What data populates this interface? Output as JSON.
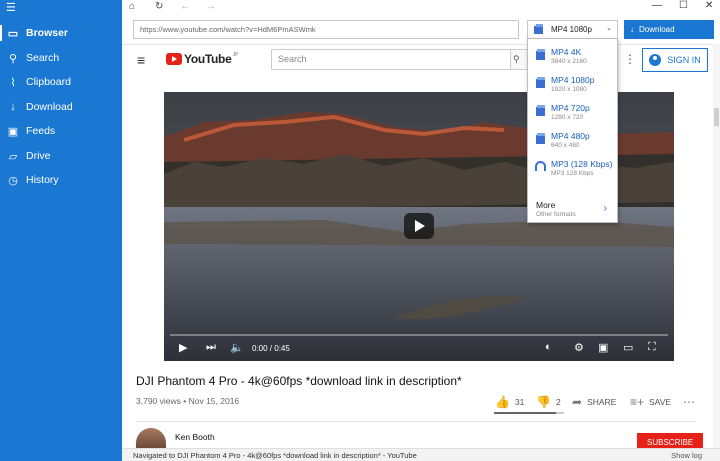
{
  "sidebar": {
    "menu_icon": "hamburger-icon",
    "items": [
      {
        "label": "Browser",
        "icon": "browser-icon",
        "active": true
      },
      {
        "label": "Search",
        "icon": "search-icon"
      },
      {
        "label": "Clipboard",
        "icon": "paperclip-icon"
      },
      {
        "label": "Download",
        "icon": "download-arrow-icon"
      },
      {
        "label": "Feeds",
        "icon": "rss-icon"
      },
      {
        "label": "Drive",
        "icon": "folder-icon"
      },
      {
        "label": "History",
        "icon": "history-icon"
      }
    ]
  },
  "toolbar": {
    "url": "https://www.youtube.com/watch?v=HdM6PmASWmk",
    "format_selected": "MP4 1080p",
    "download_label": "Download"
  },
  "format_dropdown": {
    "items": [
      {
        "title": "MP4 4K",
        "detail": "3840 x 2160",
        "icon": "video-icon"
      },
      {
        "title": "MP4 1080p",
        "detail": "1920 x 1080",
        "icon": "video-icon"
      },
      {
        "title": "MP4 720p",
        "detail": "1280 x 720",
        "icon": "video-icon"
      },
      {
        "title": "MP4 480p",
        "detail": "640 x 480",
        "icon": "video-icon"
      },
      {
        "title": "MP3 (128 Kbps)",
        "detail": "MP3 128 Kbps",
        "icon": "headphones-icon"
      }
    ],
    "more_title": "More",
    "more_detail": "Other formats"
  },
  "youtube": {
    "logo_text": "YouTube",
    "logo_region": "JP",
    "search_placeholder": "Search",
    "sign_in": "SIGN IN",
    "video": {
      "time": "0:00 / 0:45",
      "progress": 0.0
    },
    "title": "DJI Phantom 4 Pro - 4k@60fps *download link in description*",
    "views_date": "3,790 views • Nov 15, 2016",
    "likes": "31",
    "dislikes": "2",
    "like_ratio": 0.88,
    "share": "SHARE",
    "save": "SAVE",
    "channel": "Ken Booth",
    "subscribe": "SUBSCRIBE"
  },
  "status": {
    "message": "Navigated to DJI Phantom 4 Pro - 4k@60fps *download link in description* - YouTube",
    "show_log": "Show log"
  },
  "colors": {
    "accent": "#1a78d2",
    "youtube_red": "#e62117"
  }
}
